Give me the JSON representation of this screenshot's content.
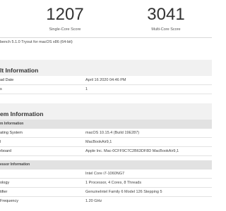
{
  "scores": {
    "single": {
      "value": "1207",
      "label": "Single-Core Score"
    },
    "multi": {
      "value": "3041",
      "label": "Multi-Core Score"
    }
  },
  "subtitle": "bench 5.1.0 Tryout for macOS x86 (64-bit)",
  "result_info": {
    "heading": "lt Information",
    "rows": [
      {
        "label": "ad Date",
        "value": "April 16 2020 04:46 PM"
      },
      {
        "label": "s",
        "value": "1"
      }
    ]
  },
  "system_info": {
    "heading": "em Information",
    "subheading": "m Information",
    "rows": [
      {
        "label": "ating System",
        "value": "macOS 10.15.4 (Build 19E287)"
      },
      {
        "label": "l",
        "value": "MacBookAir9,1"
      },
      {
        "label": "rboard",
        "value": "Apple Inc. Mac-0CFF9C7C2B63DF8D MacBookAir9,1"
      }
    ]
  },
  "processor_info": {
    "subheading": "essor Information",
    "rows": [
      {
        "label": "",
        "value": "Intel Core i7-1060NG7"
      },
      {
        "label": "ology",
        "value": "1 Processor, 4 Cores, 8 Threads"
      },
      {
        "label": "tifier",
        "value": "GenuineIntel Family 6 Model 126 Stepping 5"
      },
      {
        "label": "Frequency",
        "value": "1.20 GHz"
      }
    ]
  }
}
